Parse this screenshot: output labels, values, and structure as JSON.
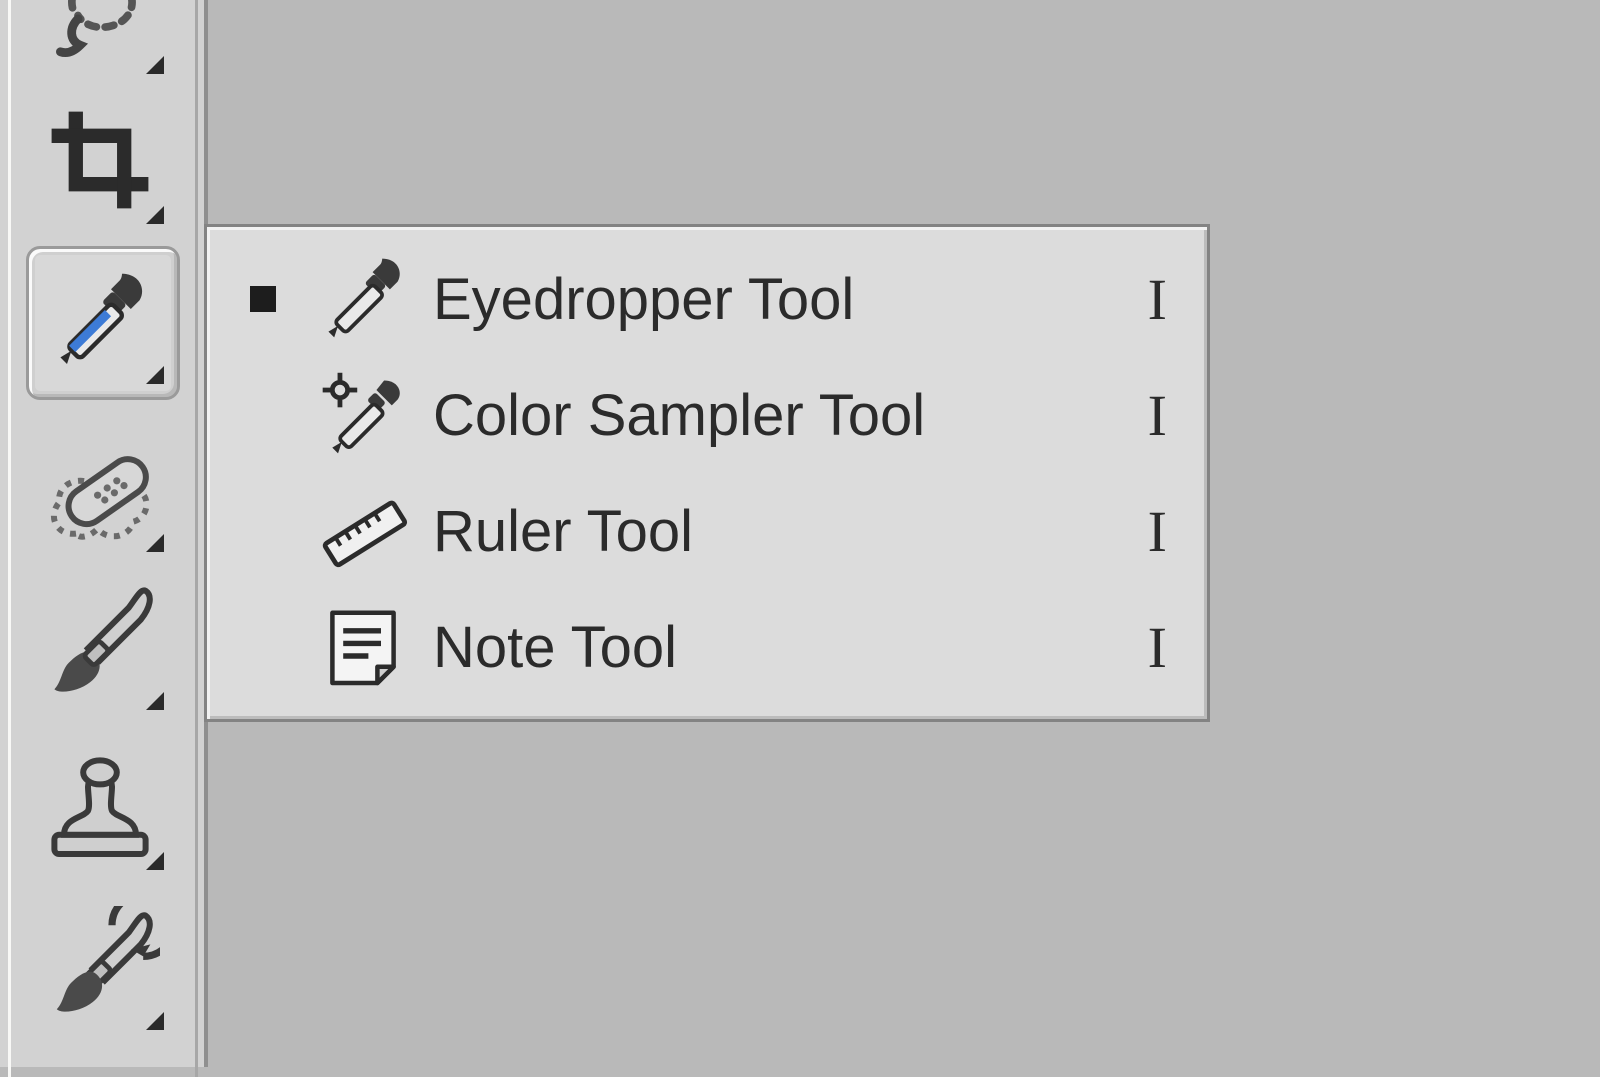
{
  "toolbar": {
    "selected_index": 2,
    "items": [
      {
        "name": "lasso-tool"
      },
      {
        "name": "crop-tool"
      },
      {
        "name": "eyedropper-tool"
      },
      {
        "name": "healing-brush-tool"
      },
      {
        "name": "brush-tool"
      },
      {
        "name": "stamp-tool"
      },
      {
        "name": "history-brush-tool"
      }
    ]
  },
  "flyout": {
    "items": [
      {
        "label": "Eyedropper Tool",
        "shortcut": "I",
        "selected": true,
        "icon": "eyedropper-icon"
      },
      {
        "label": "Color Sampler Tool",
        "shortcut": "I",
        "selected": false,
        "icon": "color-sampler-icon"
      },
      {
        "label": "Ruler Tool",
        "shortcut": "I",
        "selected": false,
        "icon": "ruler-icon"
      },
      {
        "label": "Note Tool",
        "shortcut": "I",
        "selected": false,
        "icon": "note-icon"
      }
    ]
  }
}
